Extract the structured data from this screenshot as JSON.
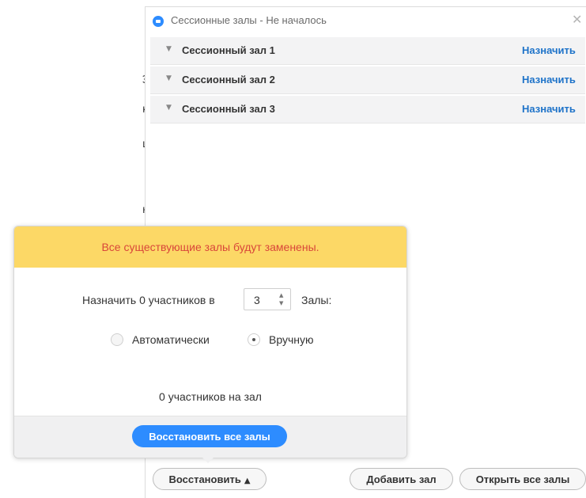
{
  "background": {
    "fragments": [
      "Э",
      "к",
      "ц",
      "н"
    ]
  },
  "window": {
    "title": "Сессионные залы - Не началось",
    "close_glyph": "✕",
    "rooms": [
      {
        "name": "Сессионный зал 1",
        "assign_label": "Назначить"
      },
      {
        "name": "Сессионный зал 2",
        "assign_label": "Назначить"
      },
      {
        "name": "Сессионный зал 3",
        "assign_label": "Назначить"
      }
    ]
  },
  "popover": {
    "warning": "Все существующие залы будут заменены.",
    "assign_prefix": "Назначить 0 участников в",
    "room_count": "3",
    "rooms_suffix": "Залы:",
    "options": {
      "auto_label": "Автоматически",
      "manual_label": "Вручную",
      "selected": "manual"
    },
    "per_room": "0 участников на зал",
    "restore_all_label": "Восстановить все залы"
  },
  "bottom_bar": {
    "restore_label": "Восстановить",
    "add_room_label": "Добавить зал",
    "open_all_label": "Открыть все залы"
  },
  "colors": {
    "accent": "#2d8cff",
    "link": "#1e73c9",
    "warning_bg": "#fcd866",
    "warning_text": "#d9473a"
  },
  "icons": {
    "app": "zoom-logo-icon",
    "close": "close-icon",
    "collapse": "caret-down-icon",
    "spinner": "spinner-arrows-icon",
    "restore_chevron": "chevron-up-icon"
  }
}
